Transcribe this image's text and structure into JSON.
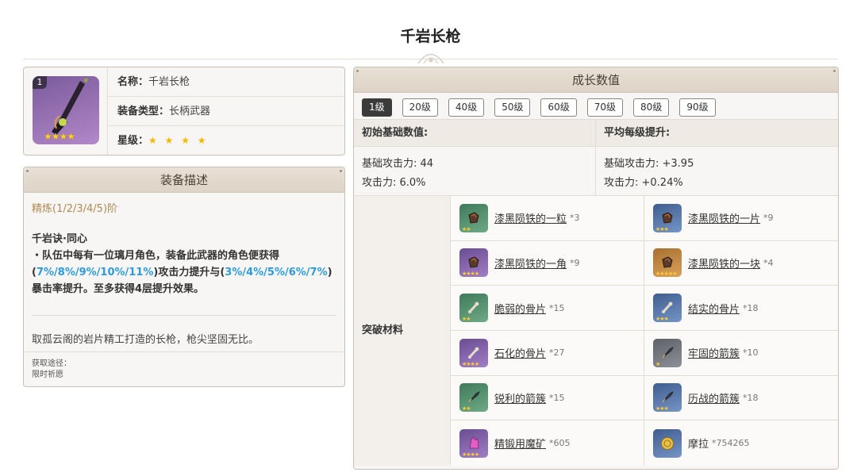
{
  "page": {
    "title": "千岩长枪"
  },
  "weapon": {
    "level_badge": "1",
    "name_key": "名称：",
    "name_value": "千岩长枪",
    "type_key": "装备类型：",
    "type_value": "长柄武器",
    "rarity_key": "星级：",
    "rarity_stars": "★ ★ ★ ★",
    "thumb_stars": "★★★★"
  },
  "description": {
    "header": "装备描述",
    "refine": "精炼(1/2/3/4/5)阶",
    "skill_name": "千岩诀·同心",
    "skill_prefix": "・队伍中每有一位璃月角色，装备此武器的角色便获得(",
    "atk_values": "7%/8%/9%/10%/11%",
    "skill_mid": ")攻击力提升与(",
    "crit_values": "3%/4%/5%/6%/7%",
    "skill_suffix": ")暴击率提升。至多获得4层提升效果。",
    "lore": "取孤云阁的岩片精工打造的长枪，枪尖坚固无比。",
    "source_label": "获取途径：",
    "source_value": "限时祈愿"
  },
  "growth": {
    "header": "成长数值",
    "tabs": [
      "1级",
      "20级",
      "40级",
      "50级",
      "60级",
      "70级",
      "80级",
      "90级"
    ],
    "active_tab": "1级",
    "base_head": "初始基础数值:",
    "avg_head": "平均每级提升:",
    "base_line1": "基础攻击力: 44",
    "base_line2": "攻击力: 6.0%",
    "avg_line1": "基础攻击力: +3.95",
    "avg_line2": "攻击力: +0.24%",
    "materials_label": "突破材料",
    "materials": [
      {
        "name": "漆黑陨铁的一粒",
        "count": "*3",
        "rarity": "r2",
        "icon": "ore-grain-icon",
        "stars": "★★"
      },
      {
        "name": "漆黑陨铁的一片",
        "count": "*9",
        "rarity": "r3",
        "icon": "ore-chunk-icon",
        "stars": "★★★"
      },
      {
        "name": "漆黑陨铁的一角",
        "count": "*9",
        "rarity": "r4",
        "icon": "ore-corner-icon",
        "stars": "★★★★"
      },
      {
        "name": "漆黑陨铁的一块",
        "count": "*4",
        "rarity": "r5",
        "icon": "ore-block-icon",
        "stars": "★★★★★"
      },
      {
        "name": "脆弱的骨片",
        "count": "*15",
        "rarity": "r2",
        "icon": "fragile-bone-icon",
        "stars": "★★"
      },
      {
        "name": "结实的骨片",
        "count": "*18",
        "rarity": "r3",
        "icon": "sturdy-bone-icon",
        "stars": "★★★"
      },
      {
        "name": "石化的骨片",
        "count": "*27",
        "rarity": "r4",
        "icon": "fossil-bone-icon",
        "stars": "★★★★"
      },
      {
        "name": "牢固的箭簇",
        "count": "*10",
        "rarity": "r1",
        "icon": "firm-arrowhead-icon",
        "stars": "★"
      },
      {
        "name": "锐利的箭簇",
        "count": "*15",
        "rarity": "r2",
        "icon": "sharp-arrowhead-icon",
        "stars": "★★"
      },
      {
        "name": "历战的箭簇",
        "count": "*18",
        "rarity": "r3",
        "icon": "weathered-arrowhead-icon",
        "stars": "★★★"
      },
      {
        "name": "精锻用魔矿",
        "count": "*605",
        "rarity": "r4",
        "icon": "enhancement-ore-icon",
        "stars": "★★★★"
      },
      {
        "name": "摩拉",
        "count": "*754265",
        "rarity": "r3",
        "icon": "mora-coin-icon",
        "stars": ""
      }
    ]
  },
  "colors": {
    "accent_highlight": "#2d9bdc",
    "refine_text": "#b08a55",
    "active_tab": "#3b3b3b",
    "star": "#f5b800"
  }
}
